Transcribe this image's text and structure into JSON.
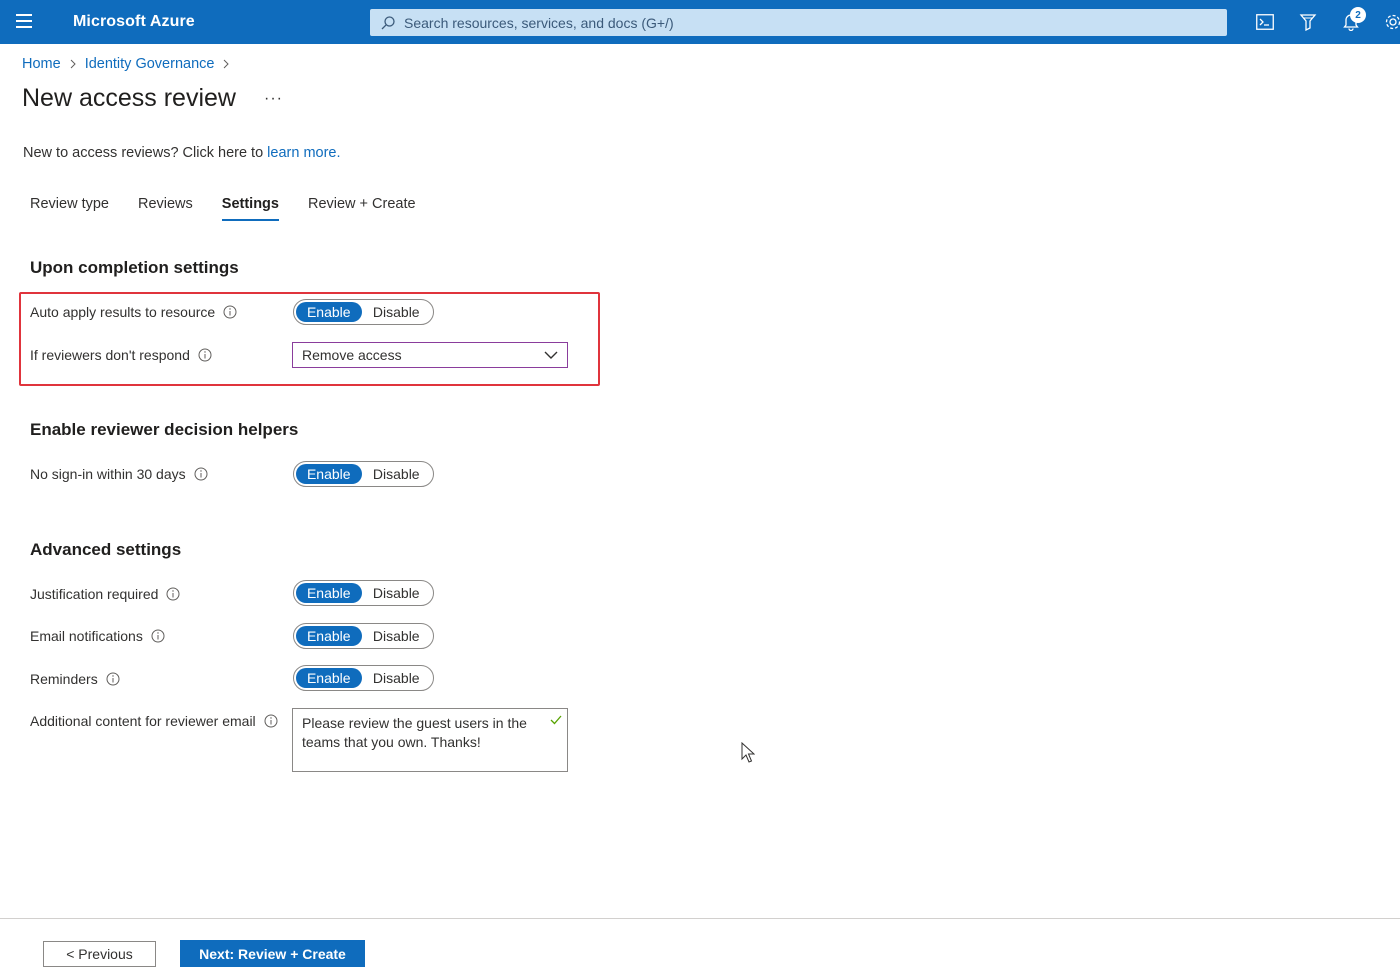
{
  "topbar": {
    "brand": "Microsoft Azure",
    "search_placeholder": "Search resources, services, and docs (G+/)",
    "notifications_count": "2",
    "icons": [
      "menu-icon",
      "search-icon",
      "cloud-shell-icon",
      "directory-filter-icon",
      "notifications-icon",
      "settings-icon"
    ]
  },
  "breadcrumb": {
    "items": [
      "Home",
      "Identity Governance"
    ]
  },
  "page": {
    "title": "New access review",
    "more": "···",
    "intro_text": "New to access reviews? Click here to ",
    "intro_link": "learn more."
  },
  "tabs": [
    {
      "label": "Review type",
      "active": false
    },
    {
      "label": "Reviews",
      "active": false
    },
    {
      "label": "Settings",
      "active": true
    },
    {
      "label": "Review + Create",
      "active": false
    }
  ],
  "sections": {
    "completion": {
      "title": "Upon completion settings",
      "auto_apply_label": "Auto apply results to resource",
      "no_response_label": "If reviewers don't respond",
      "no_response_value": "Remove access"
    },
    "helpers": {
      "title": "Enable reviewer decision helpers",
      "no_signin_label": "No sign-in within 30 days"
    },
    "advanced": {
      "title": "Advanced settings",
      "justification_label": "Justification required",
      "email_label": "Email notifications",
      "reminders_label": "Reminders",
      "additional_label": "Additional content for reviewer email",
      "additional_value": "Please review the guest users in the teams that you own. Thanks!"
    }
  },
  "toggle": {
    "enable": "Enable",
    "disable": "Disable"
  },
  "footer": {
    "previous": "< Previous",
    "next": "Next: Review + Create"
  },
  "colors": {
    "accent": "#0f6cbd",
    "highlight": "#e0343c"
  }
}
